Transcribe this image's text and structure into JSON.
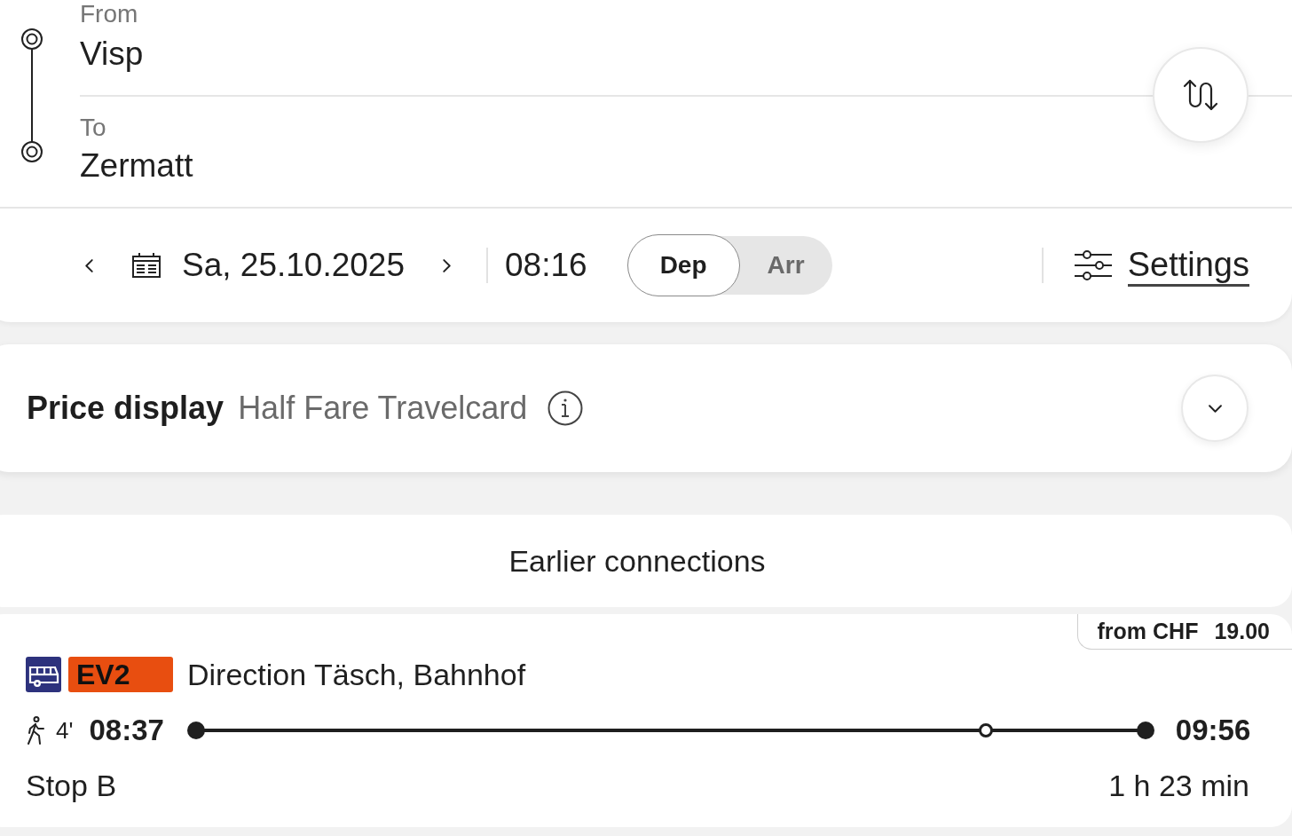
{
  "route": {
    "from": {
      "label": "From",
      "value": "Visp"
    },
    "to": {
      "label": "To",
      "value": "Zermatt"
    }
  },
  "date_bar": {
    "date": "Sa, 25.10.2025",
    "time": "08:16",
    "modes": [
      {
        "label": "Dep",
        "selected": true
      },
      {
        "label": "Arr",
        "selected": false
      }
    ],
    "settings": "Settings"
  },
  "price_display": {
    "label": "Price display",
    "value": "Half Fare Travelcard",
    "expanded": false
  },
  "earlier_connections": "Earlier connections",
  "connections": [
    {
      "price_label": "from CHF",
      "price": "19.00",
      "line": {
        "label": "EV2",
        "color": "#e84e10"
      },
      "direction": "Direction Täsch, Bahnhof",
      "walk_time": "4'",
      "departure": "08:37",
      "arrival": "09:56",
      "stop": "Stop B",
      "duration": "1 h 23 min"
    }
  ]
}
